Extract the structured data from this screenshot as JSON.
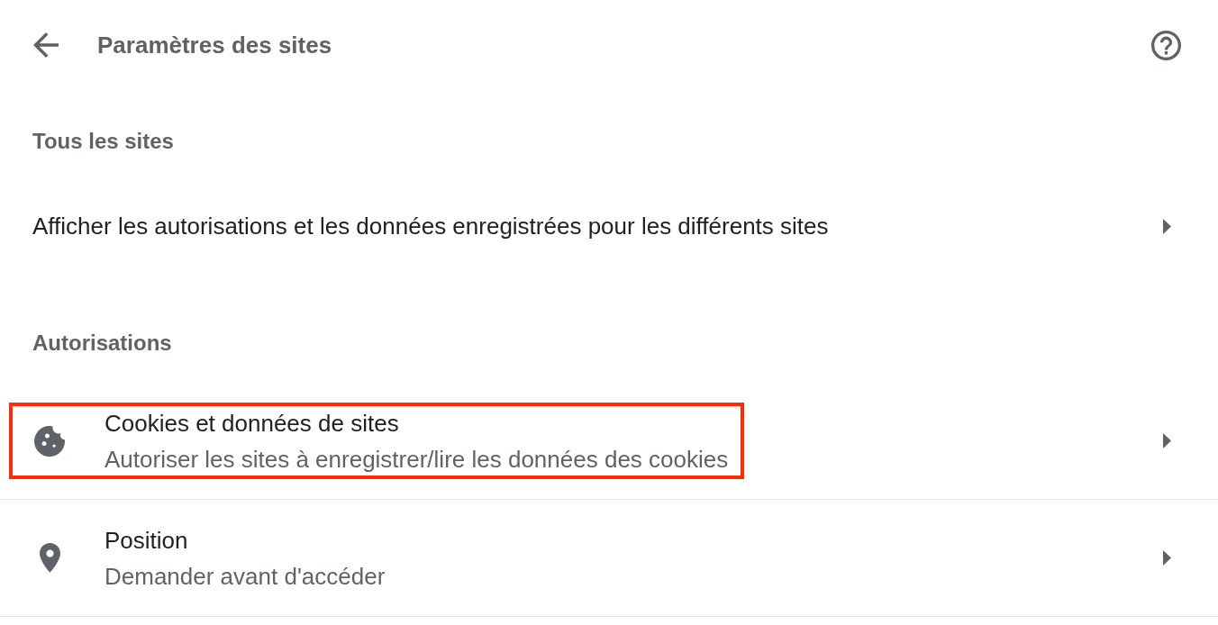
{
  "header": {
    "title": "Paramètres des sites"
  },
  "all_sites": {
    "heading": "Tous les sites",
    "link": "Afficher les autorisations et les données enregistrées pour les différents sites"
  },
  "permissions": {
    "heading": "Autorisations",
    "items": [
      {
        "title": "Cookies et données de sites",
        "subtitle": "Autoriser les sites à enregistrer/lire les données des cookies",
        "highlighted": true
      },
      {
        "title": "Position",
        "subtitle": "Demander avant d'accéder",
        "highlighted": false
      }
    ]
  }
}
